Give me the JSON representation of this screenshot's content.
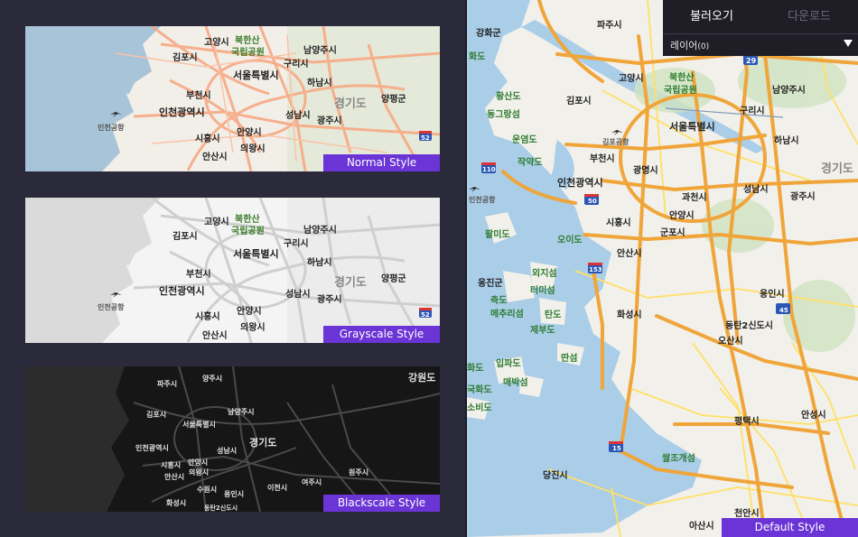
{
  "style_cards": [
    {
      "label": "Normal Style",
      "place_labels": [
        "고양시",
        "북한산",
        "국립공원",
        "남양주시",
        "김포시",
        "구리시",
        "서울특별시",
        "하남시",
        "부천시",
        "경기도",
        "양평군",
        "인천광역시",
        "성남시",
        "인천공항",
        "광주시",
        "안양시",
        "시흥시",
        "의왕시",
        "안산시"
      ],
      "road_shields": [
        "52"
      ]
    },
    {
      "label": "Grayscale Style",
      "place_labels": [
        "고양시",
        "북한산",
        "국립공원",
        "남양주시",
        "김포시",
        "구리시",
        "서울특별시",
        "하남시",
        "부천시",
        "경기도",
        "양평군",
        "인천광역시",
        "성남시",
        "인천공항",
        "광주시",
        "안양시",
        "시흥시",
        "의왕시",
        "안산시"
      ],
      "road_shields": [
        "52"
      ]
    },
    {
      "label": "Blackscale Style",
      "place_labels": [
        "파주시",
        "양주시",
        "강원도",
        "남양주시",
        "김포시",
        "서울특별시",
        "경기도",
        "인천광역시",
        "성남시",
        "시흥시",
        "안양시",
        "안산시",
        "의왕시",
        "이천시",
        "수원시",
        "여주시",
        "원주시",
        "용인시",
        "화성시",
        "동탄2신도시"
      ],
      "road_shields": []
    }
  ],
  "panel": {
    "tabs": [
      {
        "label": "불러오기",
        "active": true
      },
      {
        "label": "다운로드",
        "active": false
      }
    ],
    "layer_label": "레이어",
    "layer_count": "(0)"
  },
  "main_map": {
    "style_label": "Default Style",
    "place_labels": [
      "파주시",
      "강화군",
      "화도",
      "고양시",
      "북한산",
      "국립공원",
      "남양주시",
      "황산도",
      "동그랑섬",
      "김포시",
      "구리시",
      "서울특별시",
      "하남시",
      "운염도",
      "김포공항",
      "경기도",
      "작약도",
      "부천시",
      "광명시",
      "인천광역시",
      "성남시",
      "인천공항",
      "과천시",
      "광주시",
      "팔미도",
      "오이도",
      "시흥시",
      "군포시",
      "안양시",
      "안산시",
      "옹진군",
      "외지섬",
      "측도",
      "터미섬",
      "메추리섬",
      "탄도",
      "용인시",
      "화성시",
      "제부도",
      "동탄2신도시",
      "오산시",
      "화도",
      "입파도",
      "딴섬",
      "매박섬",
      "평택시",
      "안성시",
      "국화도",
      "소비도",
      "당진시",
      "쌀조개섬",
      "천안시",
      "아산시"
    ],
    "road_shields": [
      "29",
      "110",
      "50",
      "153",
      "15",
      "45",
      "15"
    ]
  },
  "colors": {
    "accent": "#6a34d6",
    "water": "#aacde8",
    "land": "#f3f2ee",
    "arterial": "#f5a623",
    "minor": "#ffe066"
  }
}
